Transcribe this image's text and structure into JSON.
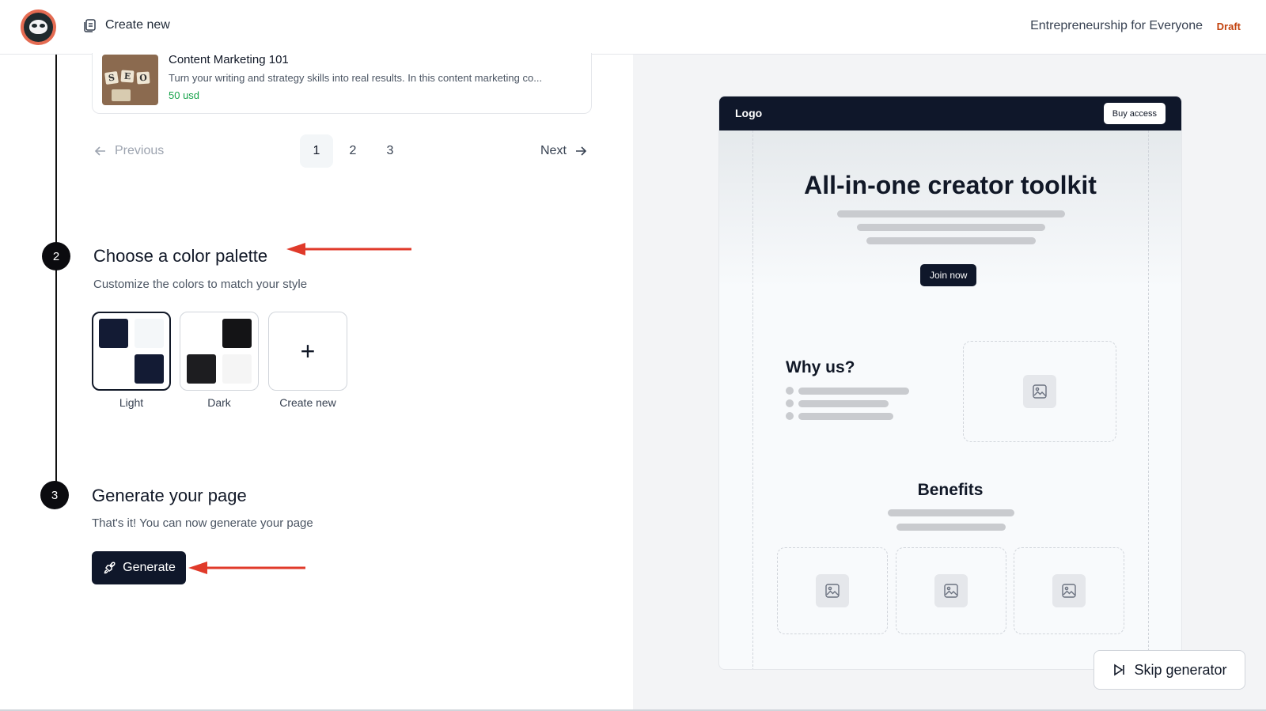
{
  "header": {
    "create_new_label": "Create new",
    "course_title": "Entrepreneurship for Everyone",
    "status_badge": "Draft"
  },
  "product_card": {
    "thumbnail_letters": [
      "S",
      "E",
      "O"
    ],
    "name": "Content Marketing 101",
    "description": "Turn your writing and strategy skills into real results. In this content marketing co...",
    "price": "50 usd"
  },
  "pagination": {
    "previous_label": "Previous",
    "next_label": "Next",
    "pages": [
      "1",
      "2",
      "3"
    ],
    "current_page": "1"
  },
  "step2": {
    "number": "2",
    "title": "Choose a color palette",
    "subtitle": "Customize the colors to match your style",
    "palettes": [
      {
        "label": "Light",
        "selected": true,
        "colors": [
          "#131b34",
          "#f4f7f9",
          "#ffffff",
          "#131b34"
        ]
      },
      {
        "label": "Dark",
        "selected": false,
        "colors": [
          "#ffffff",
          "#141416",
          "#1d1d20",
          "#f5f5f5"
        ]
      },
      {
        "label": "Create new",
        "selected": false
      }
    ]
  },
  "step3": {
    "number": "3",
    "title": "Generate your page",
    "subtitle": "That's it! You can now generate your page",
    "generate_label": "Generate"
  },
  "preview": {
    "logo": "Logo",
    "buy_access": "Buy access",
    "hero_title": "All-in-one creator toolkit",
    "join_now": "Join now",
    "why_us": "Why us?",
    "benefits": "Benefits"
  },
  "skip_label": "Skip generator",
  "colors": {
    "accent_dark": "#0f172a",
    "price_green": "#16a34a",
    "draft_orange": "#c2410c",
    "annotation_arrow": "#e03a2a"
  }
}
